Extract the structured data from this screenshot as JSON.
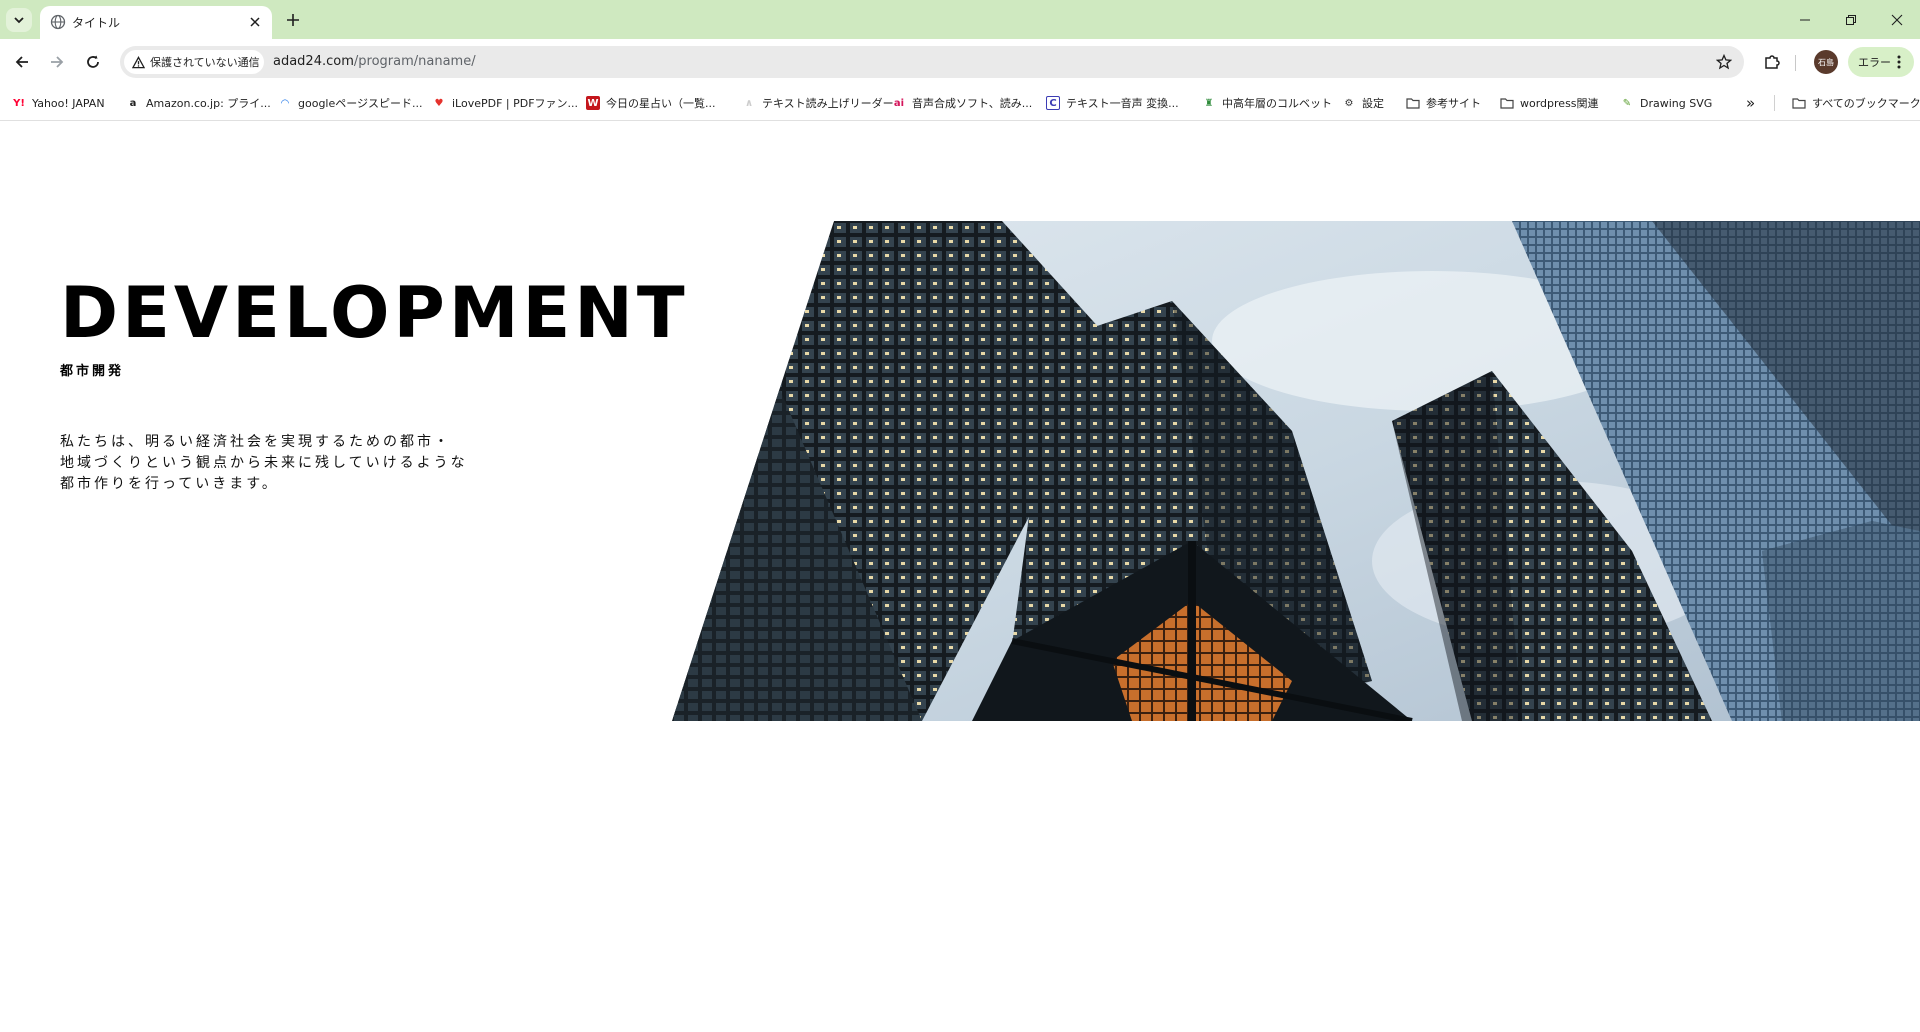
{
  "browser": {
    "tab": {
      "title": "タイトル"
    },
    "omnibox": {
      "security_label": "保護されていない通信",
      "url_host": "adad24.com",
      "url_path": "/program/naname/"
    },
    "profile": {
      "avatar_label": "石島"
    },
    "error_chip": {
      "label": "エラー"
    },
    "accent_color": "#cfe9c0"
  },
  "bookmarks": [
    {
      "icon": "Y!",
      "icon_color": "#ff0033",
      "label": "Yahoo! JAPAN"
    },
    {
      "icon": "a",
      "icon_color": "#222222",
      "label": "Amazon.co.jp: プライ..."
    },
    {
      "icon": "◠",
      "icon_color": "#1a73e8",
      "label": "googleページスピード..."
    },
    {
      "icon": "♥",
      "icon_color": "#e5322d",
      "label": "iLovePDF | PDFファン..."
    },
    {
      "icon": "W",
      "icon_color": "#c4161c",
      "label": "今日の星占い（一覧..."
    },
    {
      "icon": "∧",
      "icon_color": "#cccccc",
      "label": "テキスト読み上げリーダー"
    },
    {
      "icon": "ai",
      "icon_color": "#d4145a",
      "label": "音声合成ソフト、読み..."
    },
    {
      "icon": "C",
      "icon_color": "#3c3cb4",
      "label": "テキスト一音声 変換..."
    },
    {
      "icon": "♜",
      "icon_color": "#2e8b3a",
      "label": "中高年層のコルベット"
    },
    {
      "icon": "⚙",
      "icon_color": "#333333",
      "label": "設定"
    },
    {
      "icon": "folder",
      "icon_color": "#444444",
      "label": "参考サイト"
    },
    {
      "icon": "folder",
      "icon_color": "#444444",
      "label": "wordpress関連"
    },
    {
      "icon": "✎",
      "icon_color": "#5a9e2f",
      "label": "Drawing SVG"
    }
  ],
  "bookmarks_overflow": "»",
  "all_bookmarks_label": "すべてのブックマーク",
  "page": {
    "title": "DEVELOPMENT",
    "subtitle": "都市開発",
    "body_lines": [
      "私たちは、明るい経済社会を実現するための都市・",
      "地域づくりという観点から未来に残していけるような",
      "都市作りを行っていきます。"
    ]
  }
}
